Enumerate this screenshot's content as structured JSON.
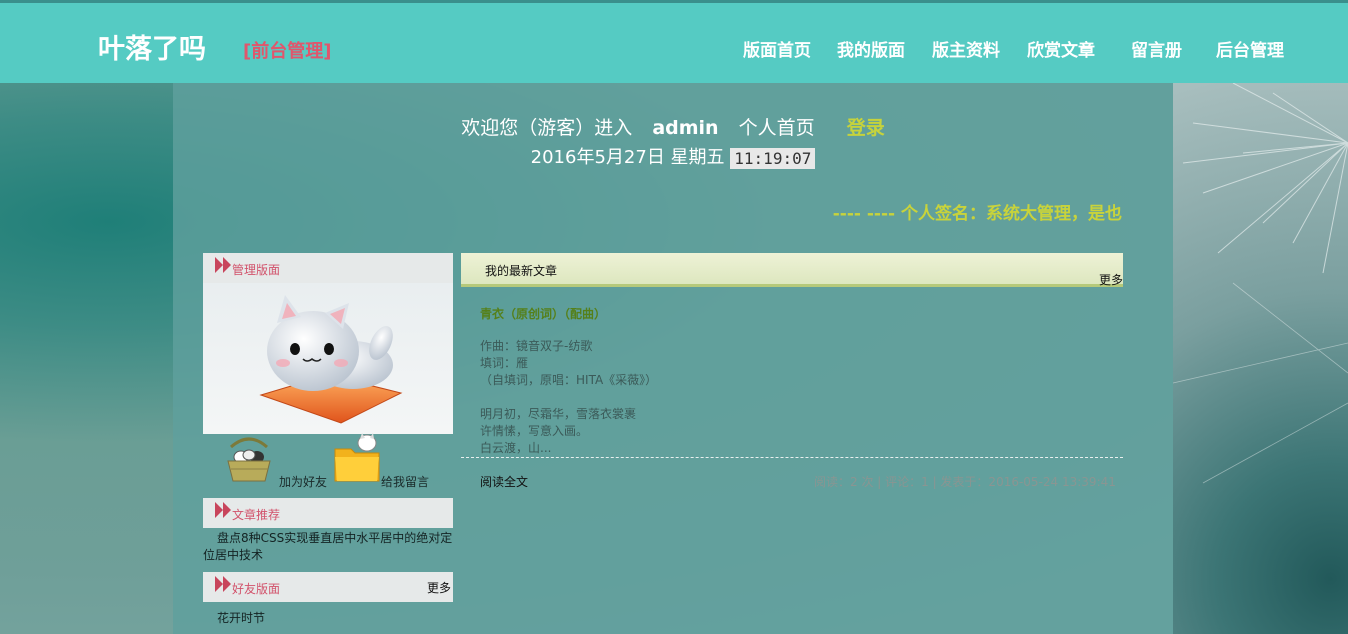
{
  "header": {
    "site_title": "叶落了吗",
    "site_subtitle": "[前台管理]",
    "nav": [
      {
        "label": "版面首页"
      },
      {
        "label": "我的版面"
      },
      {
        "label": "版主资料"
      },
      {
        "label": "欣赏文章"
      },
      {
        "label": "留言册"
      },
      {
        "label": "后台管理"
      }
    ]
  },
  "welcome": {
    "prefix": "欢迎您（游客）进入",
    "username": "admin",
    "home_text": "个人首页",
    "login": "登录",
    "date": "2016年5月27日 星期五",
    "time": "11:19:07"
  },
  "signature": "---- ---- 个人签名：系统大管理，是也",
  "sidebar": {
    "manage_title": "管理版面",
    "add_friend": "加为好友",
    "leave_message": "给我留言",
    "recommend_title": "文章推荐",
    "recommend_article": "盘点8种CSS实现垂直居中水平居中的绝对定位居中技术",
    "friends_title": "好友版面",
    "friends_more": "更多",
    "friend_item": "花开时节"
  },
  "articles": {
    "section_title": "我的最新文章",
    "more": "更多",
    "title": "青衣（原创词）（配曲）",
    "lines_1": [
      "作曲：镜音双子-纺歌",
      "填词：雁",
      "（自填词，原唱：HITA《采薇》）"
    ],
    "lines_2": [
      "明月初，尽霜华，雪落衣裳裹",
      "许情愫，写意入画。",
      "白云渡，山..."
    ],
    "read_all": "阅读全文",
    "meta": "阅读：2 次 | 评论：1 | 发表于：2016-05-24 13:39:41"
  },
  "colors": {
    "topbar": "#55cbc3",
    "accent_red": "#e0566c",
    "accent_yellow": "#c8d33b",
    "article_title_green": "#55801a"
  }
}
